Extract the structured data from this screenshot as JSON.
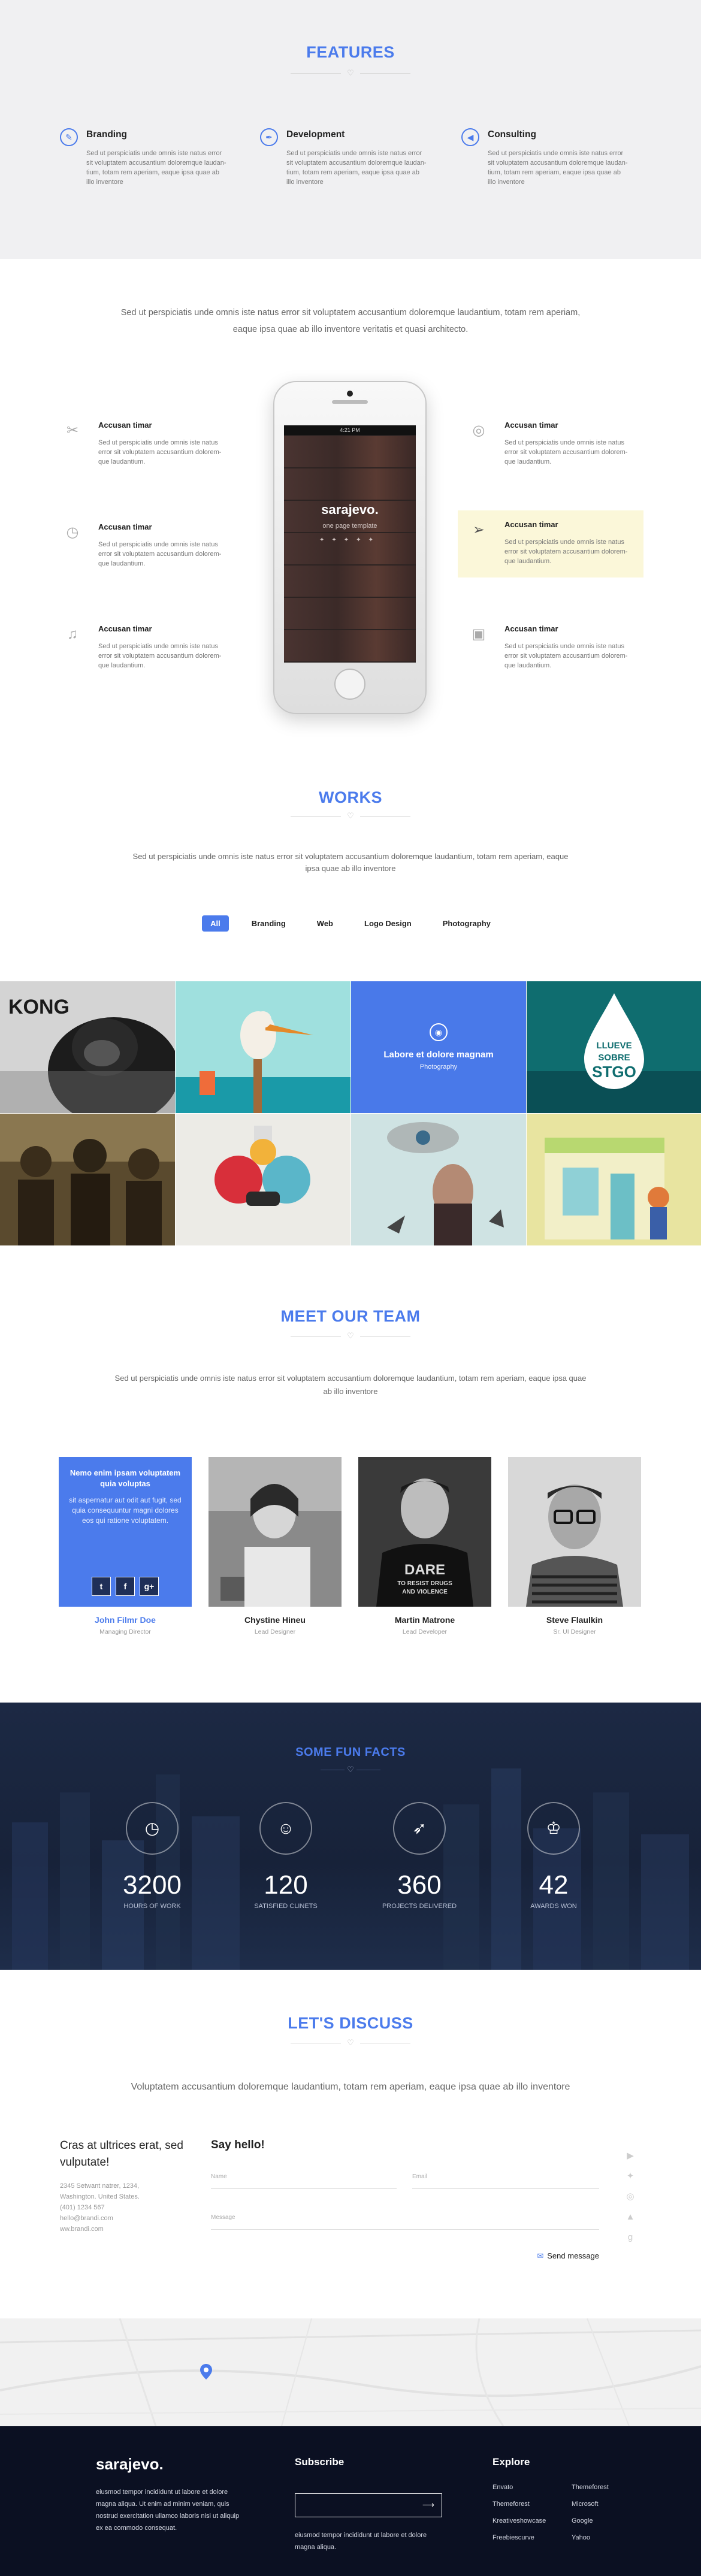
{
  "features": {
    "title": "FEATURES",
    "heart": "♡",
    "items": [
      {
        "title": "Branding",
        "text": "Sed ut perspiciatis unde omnis iste natus error sit voluptatem accusantium doloremque laudan-tium, totam rem aperiam, eaque ipsa quae ab illo inventore",
        "icon": "pencil-icon"
      },
      {
        "title": "Development",
        "text": "Sed ut perspiciatis unde omnis iste natus error sit voluptatem accusantium doloremque laudan-tium, totam rem aperiam, eaque ipsa quae ab illo inventore",
        "icon": "pen-icon"
      },
      {
        "title": "Consulting",
        "text": "Sed ut perspiciatis unde omnis iste natus error sit voluptatem accusantium doloremque laudan-tium, totam rem aperiam, eaque ipsa quae ab illo inventore",
        "icon": "megaphone-icon"
      }
    ]
  },
  "showcase": {
    "lead": "Sed ut perspiciatis unde omnis iste natus error sit voluptatem accusantium doloremque laudantium, totam rem aperiam, eaque ipsa quae ab illo inventore veritatis et quasi architecto.",
    "services": [
      {
        "title": "Accusan timar",
        "text": "Sed ut perspiciatis unde omnis iste natus error sit voluptatem accusantium dolorem-que laudantium.",
        "icon": "tools-icon"
      },
      {
        "title": "Accusan timar",
        "text": "Sed ut perspiciatis unde omnis iste natus error sit voluptatem accusantium dolorem-que laudantium.",
        "icon": "clock-icon"
      },
      {
        "title": "Accusan timar",
        "text": "Sed ut perspiciatis unde omnis iste natus error sit voluptatem accusantium dolorem-que laudantium.",
        "icon": "music-icon"
      },
      {
        "title": "Accusan timar",
        "text": "Sed ut perspiciatis unde omnis iste natus error sit voluptatem accusantium dolorem-que laudantium.",
        "icon": "lifebuoy-icon"
      },
      {
        "title": "Accusan timar",
        "text": "Sed ut perspiciatis unde omnis iste natus error sit voluptatem accusantium dolorem-que laudantium.",
        "icon": "paper-plane-icon"
      },
      {
        "title": "Accusan timar",
        "text": "Sed ut perspiciatis unde omnis iste natus error sit voluptatem accusantium dolorem-que laudantium.",
        "icon": "camera-icon"
      }
    ],
    "phone": {
      "status_time": "4:21 PM",
      "brand": "sarajevo.",
      "tagline": "one page template"
    }
  },
  "works": {
    "title": "WORKS",
    "heart": "♡",
    "lead": "Sed ut perspiciatis unde omnis iste natus error sit voluptatem accusantium doloremque laudantium, totam rem aperiam, eaque ipsa quae ab illo inventore",
    "filters": [
      "All",
      "Branding",
      "Web",
      "Logo Design",
      "Photography"
    ],
    "overlay": {
      "title": "Labore et dolore magnam",
      "subtitle": "Photography"
    },
    "tile_texts": {
      "kong": "KONG",
      "drop": [
        "LLUEVE",
        "SOBRE",
        "STGO"
      ]
    }
  },
  "team": {
    "title": "MEET OUR TEAM",
    "heart": "♡",
    "lead": "Sed ut perspiciatis unde omnis iste natus error sit voluptatem accusantium doloremque laudantium, totam rem aperiam, eaque ipsa quae ab illo inventore",
    "members": [
      {
        "name": "John Filmr Doe",
        "role": "Managing Director"
      },
      {
        "name": "Chystine Hineu",
        "role": "Lead Designer"
      },
      {
        "name": "Martin Matrone",
        "role": "Lead Developer"
      },
      {
        "name": "Steve Flaulkin",
        "role": "Sr. UI Designer"
      }
    ],
    "bio": {
      "title": "Nemo enim ipsam voluptatem quia voluptas",
      "text": "sit aspernatur aut odit aut fugit, sed quia consequuntur magni dolores eos qui ratione voluptatem.",
      "social": [
        "t",
        "f",
        "g+"
      ]
    },
    "shirt_text": [
      "DARE",
      "TO RESIST DRUGS",
      "AND VIOLENCE"
    ]
  },
  "facts": {
    "title": "SOME FUN FACTS",
    "heart": "♡",
    "items": [
      {
        "num": "3200",
        "label": "HOURS OF WORK",
        "icon": "clock-icon"
      },
      {
        "num": "120",
        "label": "SATISFIED CLINETS",
        "icon": "user-icon"
      },
      {
        "num": "360",
        "label": "PROJECTS DELIVERED",
        "icon": "rocket-icon"
      },
      {
        "num": "42",
        "label": "AWARDS WON",
        "icon": "trophy-icon"
      }
    ]
  },
  "discuss": {
    "title": "LET'S DISCUSS",
    "heart": "♡",
    "lead": "Voluptatem accusantium doloremque laudantium, totam rem aperiam, eaque ipsa quae ab illo inventore",
    "left_title": "Cras at ultrices erat, sed vulputate!",
    "address": [
      "2345 Setwant natrer, 1234,",
      "Washington. United States.",
      "(401) 1234 567",
      "hello@brandi.com",
      "ww.brandi.com"
    ],
    "form_title": "Say hello!",
    "name_ph": "Name",
    "email_ph": "Email",
    "message_ph": "Message",
    "send": "Send message"
  },
  "footer": {
    "logo": "sarajevo.",
    "about": "eiusmod tempor incididunt ut labore et dolore magna aliqua. Ut enim ad minim veniam, quis nostrud exercitation ullamco laboris nisi ut aliquip ex ea commodo consequat.",
    "subscribe_title": "Subscribe",
    "subscribe_text": "eiusmod tempor incididunt ut labore et dolore magna aliqua.",
    "explore_title": "Explore",
    "explore_col1": [
      "Envato",
      "Themeforest",
      "Kreativeshowcase",
      "Freebiescurve"
    ],
    "explore_col2": [
      "Themeforest",
      "Microsoft",
      "Google",
      "Yahoo"
    ]
  },
  "colors": {
    "accent": "#4b7bec",
    "dark": "#0b1022",
    "highlight": "#fbf7d9"
  }
}
